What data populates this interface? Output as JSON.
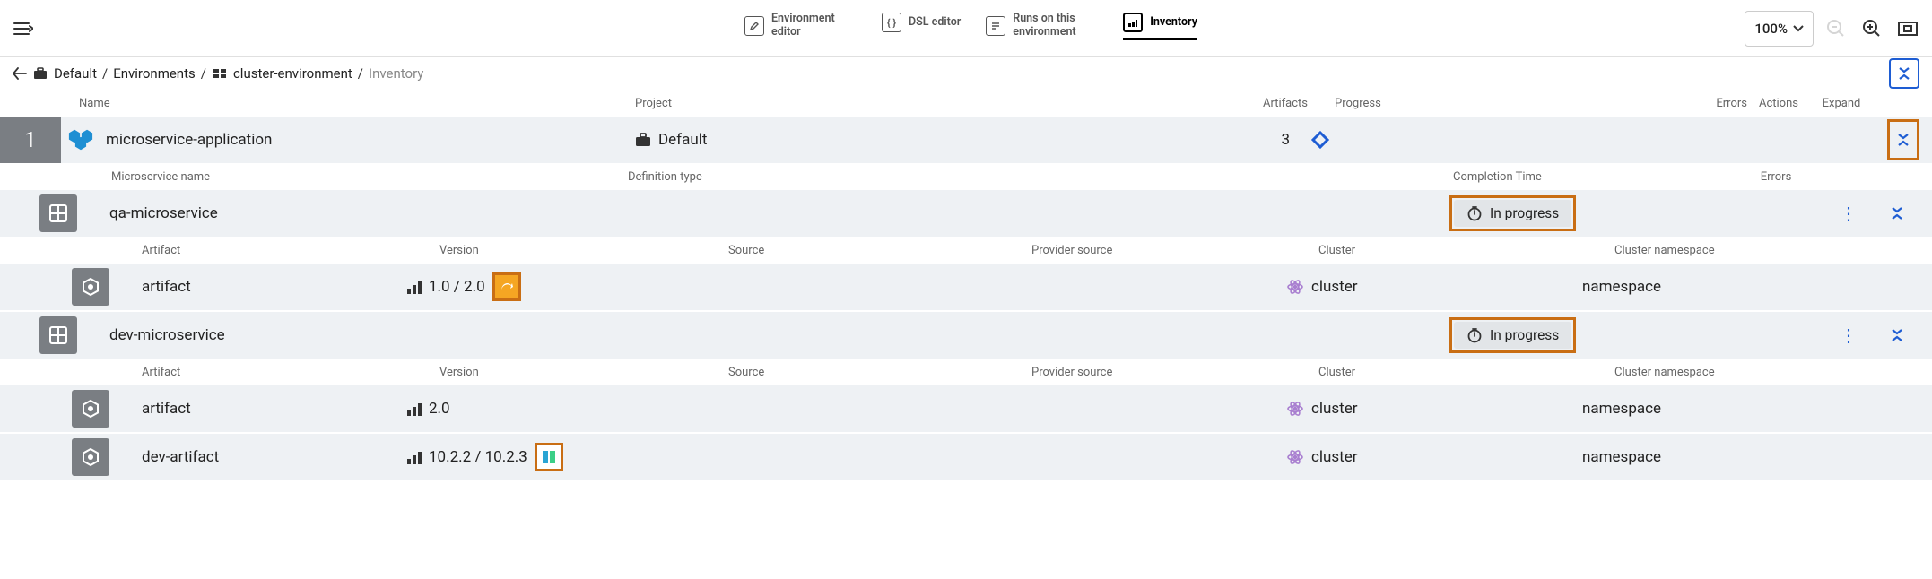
{
  "toolbar": {
    "tabs": [
      {
        "label": "Environment editor"
      },
      {
        "label": "DSL editor"
      },
      {
        "label": "Runs on this environment"
      },
      {
        "label": "Inventory"
      }
    ],
    "zoom": "100%"
  },
  "breadcrumb": {
    "root": "Default",
    "section": "Environments",
    "env": "cluster-environment",
    "page": "Inventory"
  },
  "columns": {
    "name": "Name",
    "project": "Project",
    "artifacts": "Artifacts",
    "progress": "Progress",
    "errors": "Errors",
    "actions": "Actions",
    "expand": "Expand"
  },
  "app": {
    "index": "1",
    "name": "microservice-application",
    "project": "Default",
    "artifact_count": "3"
  },
  "ms_columns": {
    "name": "Microservice name",
    "def": "Definition type",
    "completion": "Completion Time",
    "errors": "Errors"
  },
  "art_columns": {
    "artifact": "Artifact",
    "version": "Version",
    "source": "Source",
    "psource": "Provider source",
    "cluster": "Cluster",
    "ns": "Cluster namespace"
  },
  "status": {
    "in_progress": "In progress"
  },
  "microservices": [
    {
      "name": "qa-microservice",
      "status": "In progress",
      "artifacts": [
        {
          "name": "artifact",
          "version": "1.0 / 2.0",
          "badge": "orange",
          "cluster": "cluster",
          "ns": "namespace"
        }
      ]
    },
    {
      "name": "dev-microservice",
      "status": "In progress",
      "artifacts": [
        {
          "name": "artifact",
          "version": "2.0",
          "badge": "none",
          "cluster": "cluster",
          "ns": "namespace"
        },
        {
          "name": "dev-artifact",
          "version": "10.2.2 / 10.2.3",
          "badge": "blue",
          "cluster": "cluster",
          "ns": "namespace"
        }
      ]
    }
  ]
}
